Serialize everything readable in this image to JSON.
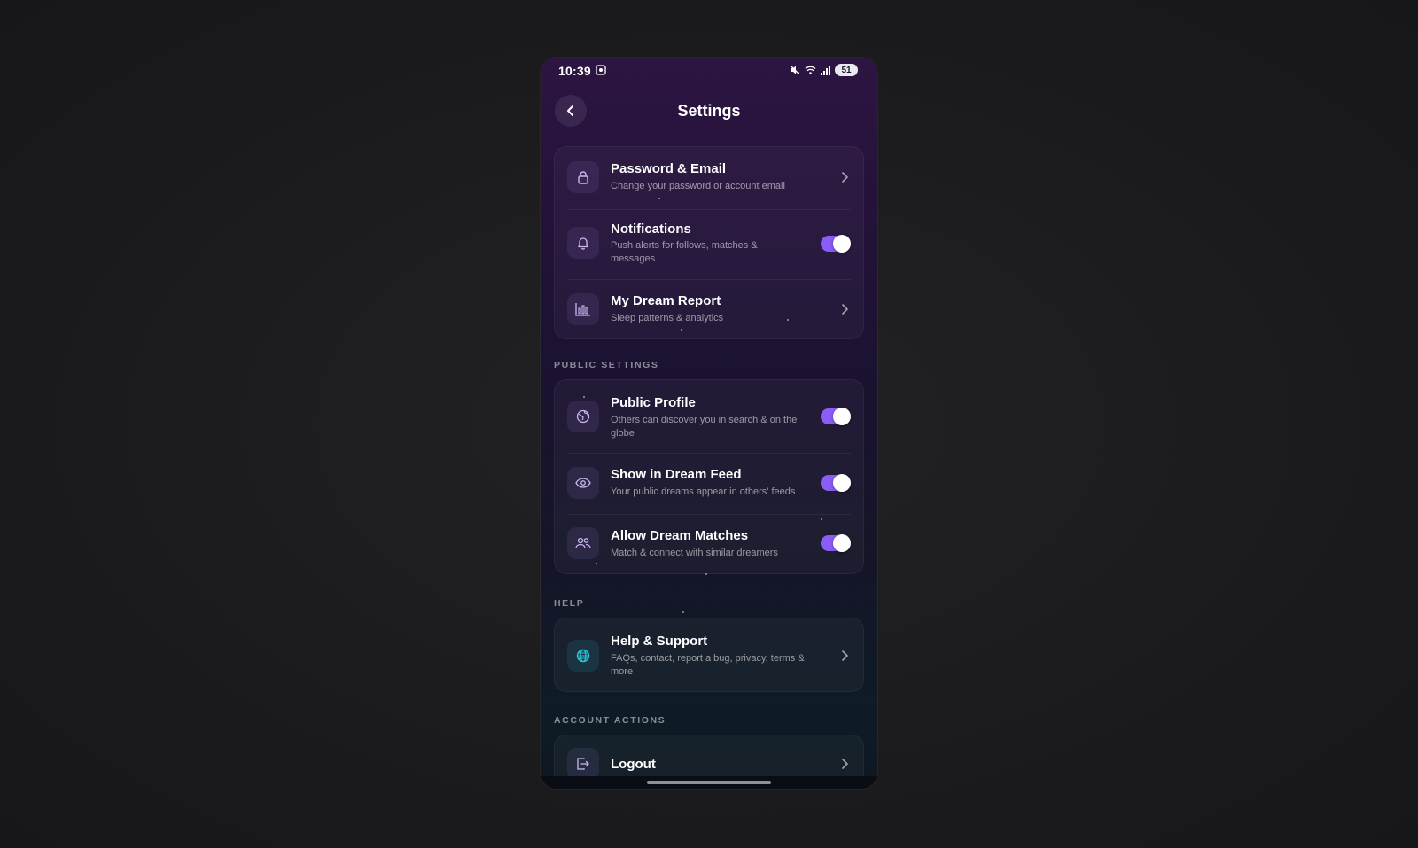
{
  "status_bar": {
    "time": "10:39",
    "battery": "51",
    "icons": [
      "screen-record-icon",
      "mute-icon",
      "wifi-icon",
      "signal-icon",
      "battery-icon"
    ]
  },
  "header": {
    "title": "Settings",
    "back_icon": "chevron-left-icon"
  },
  "account_group": {
    "items": [
      {
        "title": "Password & Email",
        "subtitle": "Change your password or account email",
        "icon": "lock-icon",
        "control": "chevron"
      },
      {
        "title": "Notifications",
        "subtitle": "Push alerts for follows, matches & messages",
        "icon": "bell-icon",
        "control": "toggle",
        "enabled": true
      },
      {
        "title": "My Dream Report",
        "subtitle": "Sleep patterns & analytics",
        "icon": "bar-chart-icon",
        "control": "chevron"
      }
    ]
  },
  "public_settings": {
    "label": "PUBLIC SETTINGS",
    "items": [
      {
        "title": "Public Profile",
        "subtitle": "Others can discover you in search & on the globe",
        "icon": "globe-icon",
        "control": "toggle",
        "enabled": true
      },
      {
        "title": "Show in Dream Feed",
        "subtitle": "Your public dreams appear in others' feeds",
        "icon": "eye-icon",
        "control": "toggle",
        "enabled": true
      },
      {
        "title": "Allow Dream Matches",
        "subtitle": "Match & connect with similar dreamers",
        "icon": "users-icon",
        "control": "toggle",
        "enabled": true
      }
    ]
  },
  "help": {
    "label": "HELP",
    "items": [
      {
        "title": "Help & Support",
        "subtitle": "FAQs, contact, report a bug, privacy, terms & more",
        "icon": "help-globe-icon",
        "control": "chevron"
      }
    ]
  },
  "account_actions": {
    "label": "ACCOUNT ACTIONS",
    "items": [
      {
        "title": "Logout",
        "icon": "logout-icon",
        "control": "chevron"
      }
    ]
  },
  "colors": {
    "accent": "#8b5cf6",
    "teal": "#2fc6d6",
    "background_top": "#2d1542",
    "background_bottom": "#0d1822"
  }
}
